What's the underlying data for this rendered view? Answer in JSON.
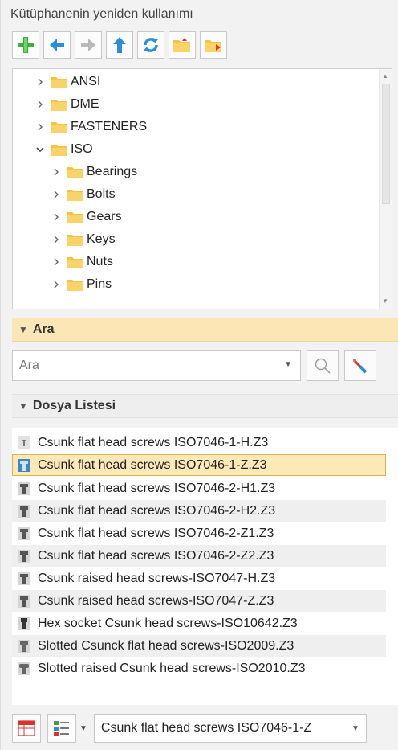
{
  "title": "Kütüphanenin yeniden kullanımı",
  "toolbar": {
    "buttons": [
      "add-icon",
      "back-icon",
      "forward-icon",
      "up-icon",
      "refresh-icon",
      "folder-open-icon",
      "folder-export-icon"
    ]
  },
  "tree": {
    "items": [
      {
        "label": "ANSI",
        "expanded": false,
        "level": 0
      },
      {
        "label": "DME",
        "expanded": false,
        "level": 0
      },
      {
        "label": "FASTENERS",
        "expanded": false,
        "level": 0
      },
      {
        "label": "ISO",
        "expanded": true,
        "level": 0
      },
      {
        "label": "Bearings",
        "expanded": false,
        "level": 1
      },
      {
        "label": "Bolts",
        "expanded": false,
        "level": 1
      },
      {
        "label": "Gears",
        "expanded": false,
        "level": 1
      },
      {
        "label": "Keys",
        "expanded": false,
        "level": 1
      },
      {
        "label": "Nuts",
        "expanded": false,
        "level": 1
      },
      {
        "label": "Pins",
        "expanded": false,
        "level": 1
      }
    ]
  },
  "search": {
    "header": "Ara",
    "placeholder": "Ara"
  },
  "file_list": {
    "header": "Dosya Listesi",
    "selected_index": 1,
    "items": [
      "Csunk flat head screws ISO7046-1-H.Z3",
      "Csunk flat head screws ISO7046-1-Z.Z3",
      "Csunk flat head screws ISO7046-2-H1.Z3",
      "Csunk flat head screws ISO7046-2-H2.Z3",
      "Csunk flat head screws ISO7046-2-Z1.Z3",
      "Csunk flat head screws ISO7046-2-Z2.Z3",
      "Csunk raised head screws-ISO7047-H.Z3",
      "Csunk raised head screws-ISO7047-Z.Z3",
      "Hex socket Csunk head screws-ISO10642.Z3",
      "Slotted Csunck flat head screws-ISO2009.Z3",
      "Slotted raised Csunk head screws-ISO2010.Z3"
    ]
  },
  "bottom": {
    "combo_value": "Csunk flat head screws ISO7046-1-Z"
  },
  "colors": {
    "selected_bg": "#fde8b8",
    "ara_header_bg": "#fbe7b5",
    "folder": "#f5c342"
  }
}
